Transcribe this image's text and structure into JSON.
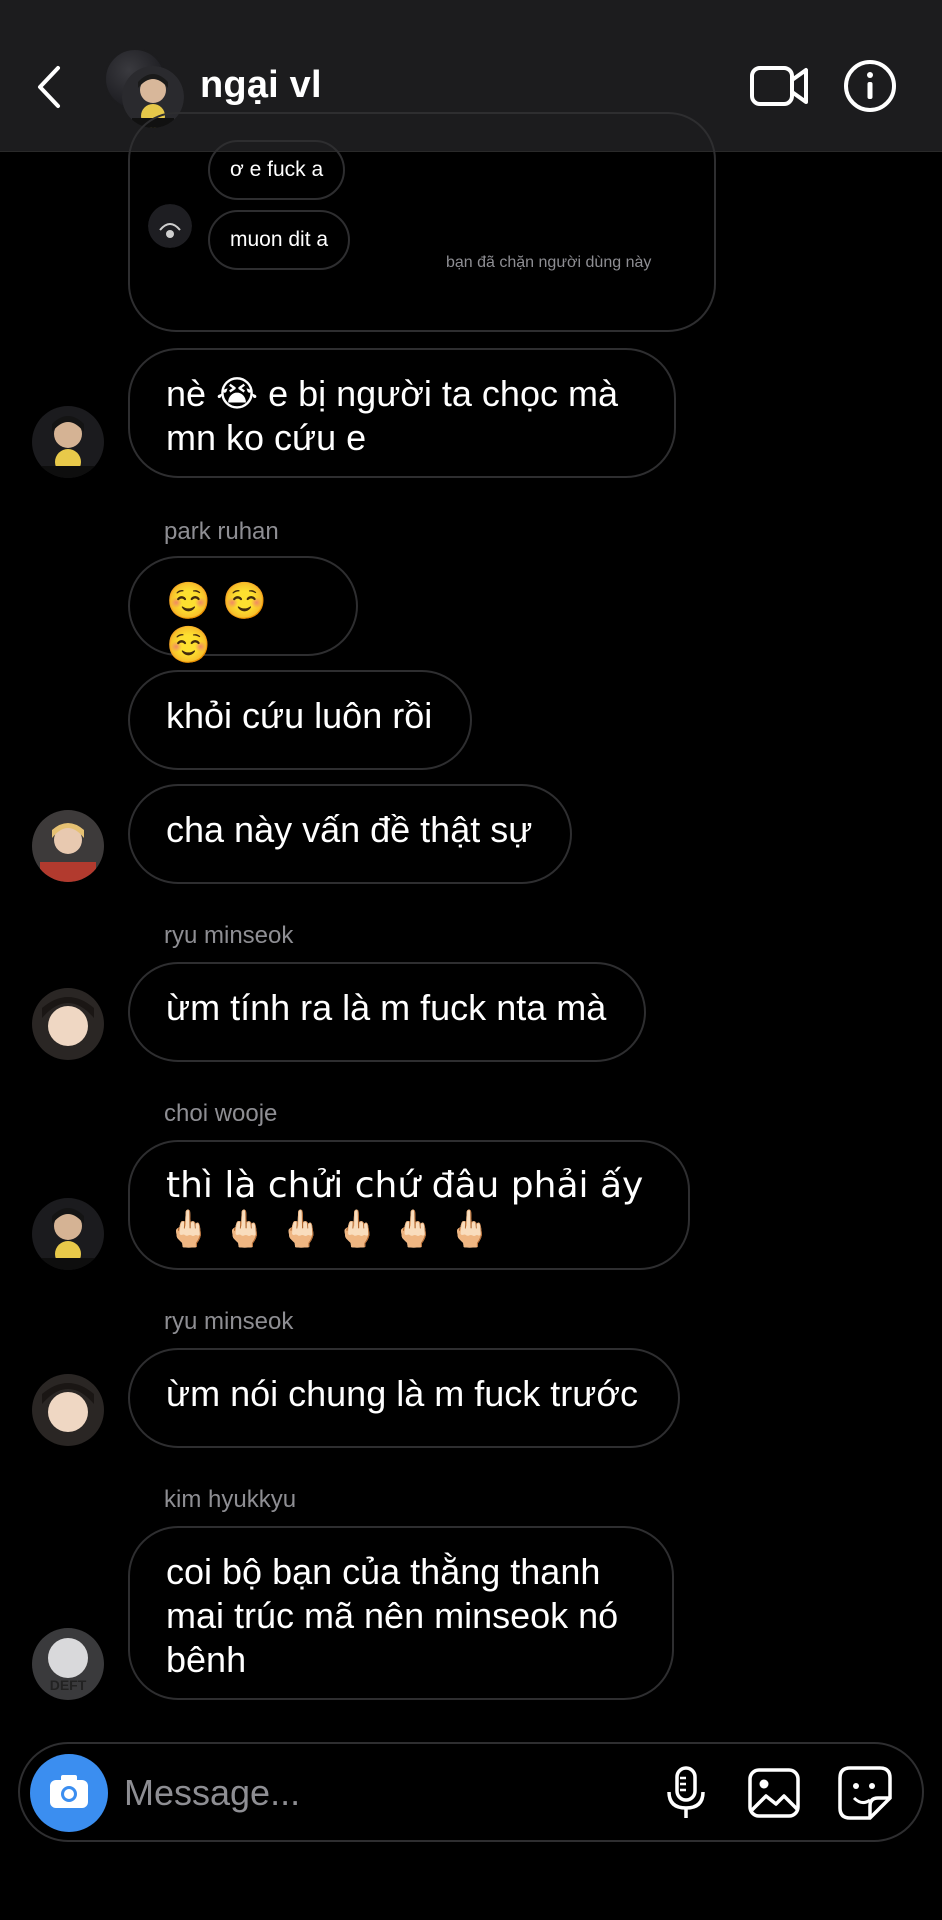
{
  "header": {
    "contact_name": "ngại vl",
    "icons": [
      "back-chevron-icon",
      "video-camera-icon",
      "info-icon"
    ]
  },
  "reply_card": {
    "messages": [
      "ơ e fuck a",
      "muon dit a"
    ],
    "blocked_note": "bạn đã chặn người dùng này"
  },
  "messages": [
    {
      "sender": "",
      "text": "nè 😭 e bị người ta chọc mà mn ko cứu e"
    },
    {
      "sender": "park ruhan",
      "text": "☺️ ☺️ ☺️"
    },
    {
      "sender": "",
      "text": "khỏi cứu luôn rồi"
    },
    {
      "sender": "",
      "text": "cha này vấn đề thật sự"
    },
    {
      "sender": "ryu minseok",
      "text": "ừm tính ra là m fuck nta mà"
    },
    {
      "sender": "choi wooje",
      "text": "thì là chửi chứ đâu phải ấy 🖕🏻 🖕🏻 🖕🏻 🖕🏻 🖕🏻 🖕🏻"
    },
    {
      "sender": "ryu minseok",
      "text": "ừm nói chung là m fuck trước"
    },
    {
      "sender": "kim hyukkyu",
      "text": "coi bộ bạn của thằng thanh mai trúc mã nên minseok nó bênh"
    }
  ],
  "composer": {
    "placeholder": "Message...",
    "icons": [
      "camera-icon",
      "microphone-icon",
      "gallery-icon",
      "sticker-icon"
    ]
  },
  "colors": {
    "background": "#000000",
    "header": "#1c1c1e",
    "bubble_border": "#2e2e30",
    "secondary_text": "#8e8e93",
    "accent": "#3b8ef0"
  }
}
